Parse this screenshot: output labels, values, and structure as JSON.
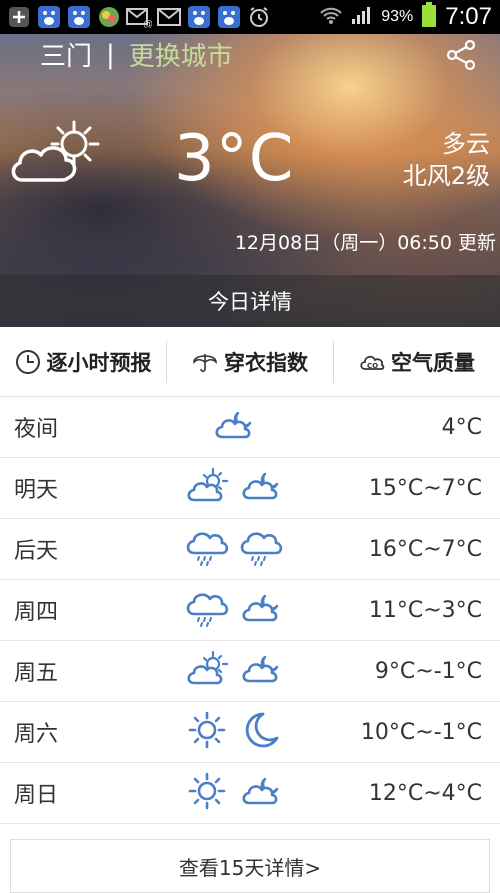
{
  "status_bar": {
    "battery_text": "93%",
    "time": "7:07",
    "icons": [
      "plus-icon",
      "baidu-icon",
      "baidu-icon",
      "app-icon",
      "mail-at-icon",
      "mail-icon",
      "baidu-icon",
      "baidu-icon",
      "alarm-icon",
      "wifi-icon",
      "signal-icon",
      "battery-icon"
    ]
  },
  "header": {
    "city": "三门",
    "separator": "|",
    "change_city": "更换城市",
    "share_icon": "share-icon"
  },
  "current": {
    "temperature": "3°C",
    "condition": "多云",
    "wind": "北风2级",
    "update_time": "12月08日（周一）06:50 更新",
    "today_detail": "今日详情"
  },
  "tabs": [
    {
      "label": "逐小时预报",
      "icon": "clock-icon"
    },
    {
      "label": "穿衣指数",
      "icon": "umbrella-icon"
    },
    {
      "label": "空气质量",
      "icon": "air-quality-icon"
    }
  ],
  "forecast": [
    {
      "day": "夜间",
      "icons": [
        "cloudy-night-icon"
      ],
      "range": "4°C"
    },
    {
      "day": "明天",
      "icons": [
        "partly-cloudy-day-icon",
        "cloudy-night-icon"
      ],
      "range": "15°C~7°C"
    },
    {
      "day": "后天",
      "icons": [
        "rain-icon",
        "rain-icon"
      ],
      "range": "16°C~7°C"
    },
    {
      "day": "周四",
      "icons": [
        "rain-icon",
        "cloudy-night-icon"
      ],
      "range": "11°C~3°C"
    },
    {
      "day": "周五",
      "icons": [
        "partly-cloudy-day-icon",
        "cloudy-night-icon"
      ],
      "range": "9°C~-1°C"
    },
    {
      "day": "周六",
      "icons": [
        "sun-icon",
        "moon-icon"
      ],
      "range": "10°C~-1°C"
    },
    {
      "day": "周日",
      "icons": [
        "sun-icon",
        "cloudy-night-icon"
      ],
      "range": "12°C~4°C"
    }
  ],
  "more_button": "查看15天详情>",
  "colors": {
    "icon_blue": "#4a7fc6",
    "change_city": "#c6dc98"
  }
}
